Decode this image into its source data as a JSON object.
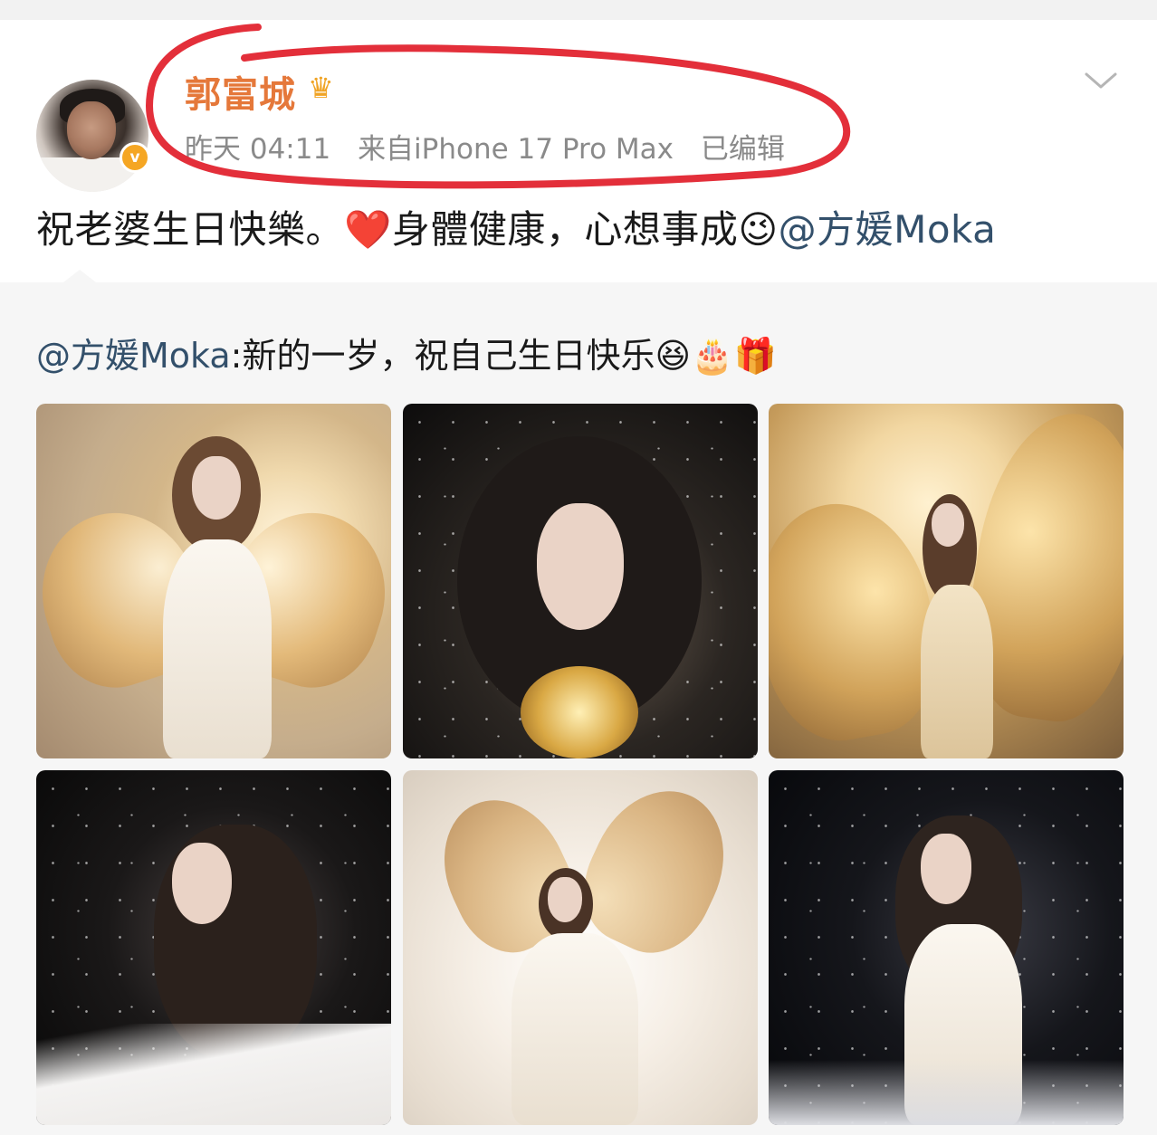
{
  "post": {
    "author": "郭富城",
    "crown_icon": "crown-icon",
    "verified_label": "v",
    "time": "昨天 04:11",
    "source": "来自iPhone 17 Pro Max",
    "edited": "已编辑",
    "text_main": "祝老婆生日快樂。",
    "emoji_heart": "❤️",
    "text_wish": "身體健康，心想事成",
    "emoji_wink": "😉",
    "mention": "@方媛Moka"
  },
  "repost": {
    "mention": "@方媛Moka",
    "text": ":新的一岁，祝自己生日快乐",
    "emoji_party": "😆",
    "emoji_cake": "🎂",
    "emoji_gift": "🎁"
  },
  "colors": {
    "author_name": "#e5783a",
    "verified_badge": "#f5a623",
    "mention": "#33506b",
    "annotation_red": "#e32f3a"
  },
  "images": [
    {
      "name": "angel-moon-gold-wings"
    },
    {
      "name": "angel-starry-golden-rose"
    },
    {
      "name": "angel-full-moon-gold-wings"
    },
    {
      "name": "angel-starry-white-dress"
    },
    {
      "name": "angel-white-background-wings"
    },
    {
      "name": "angel-starry-white-dress-2"
    }
  ]
}
